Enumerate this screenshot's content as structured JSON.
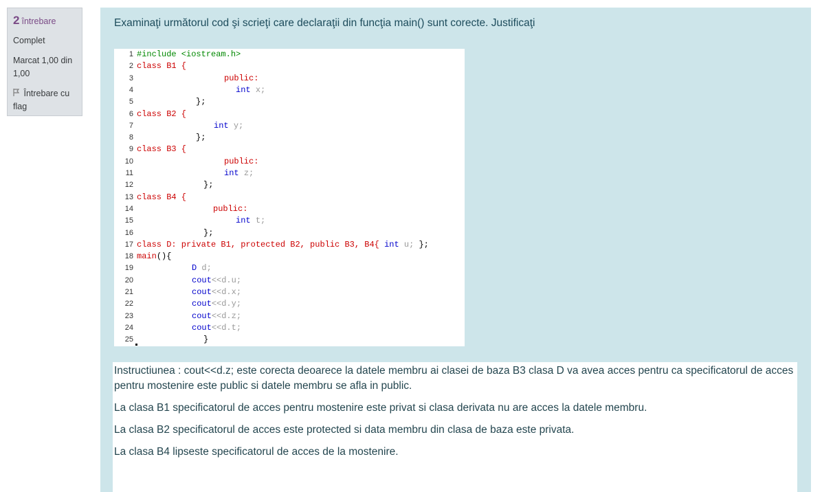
{
  "question_info": {
    "number": "2",
    "label": "întrebare",
    "status": "Complet",
    "mark": "Marcat 1,00 din 1,00",
    "flag_label": "Întrebare cu flag"
  },
  "question": {
    "text": "Examinaţi următorul cod şi scrieţi care declaraţii din funcţia main() sunt corecte. Justificaţi"
  },
  "code_lines": [
    {
      "n": "1",
      "indent": 0,
      "parts": [
        [
          "pp",
          "#include <iostream.h>"
        ]
      ]
    },
    {
      "n": "2",
      "indent": 0,
      "parts": [
        [
          "kw",
          "class B1 {"
        ]
      ]
    },
    {
      "n": "3",
      "indent": 127,
      "parts": [
        [
          "kw",
          "public:"
        ]
      ]
    },
    {
      "n": "4",
      "indent": 144,
      "parts": [
        [
          "ty",
          "int "
        ],
        [
          "id",
          "x;"
        ]
      ]
    },
    {
      "n": "5",
      "indent": 86,
      "parts": [
        [
          "",
          "};"
        ]
      ]
    },
    {
      "n": "6",
      "indent": 0,
      "parts": [
        [
          "kw",
          "class B2 {"
        ]
      ]
    },
    {
      "n": "7",
      "indent": 112,
      "parts": [
        [
          "ty",
          "int "
        ],
        [
          "id",
          "y;"
        ]
      ]
    },
    {
      "n": "8",
      "indent": 86,
      "parts": [
        [
          "",
          "};"
        ]
      ]
    },
    {
      "n": "9",
      "indent": 0,
      "parts": [
        [
          "kw",
          "class B3 {"
        ]
      ]
    },
    {
      "n": "10",
      "indent": 127,
      "parts": [
        [
          "kw",
          "public:"
        ]
      ]
    },
    {
      "n": "11",
      "indent": 127,
      "parts": [
        [
          "ty",
          "int "
        ],
        [
          "id",
          "z;"
        ]
      ]
    },
    {
      "n": "12",
      "indent": 97,
      "parts": [
        [
          "",
          "};"
        ]
      ]
    },
    {
      "n": "13",
      "indent": 0,
      "parts": [
        [
          "kw",
          "class B4 {"
        ]
      ]
    },
    {
      "n": "14",
      "indent": 111,
      "parts": [
        [
          "kw",
          "public:"
        ]
      ]
    },
    {
      "n": "15",
      "indent": 144,
      "parts": [
        [
          "ty",
          "int "
        ],
        [
          "id",
          "t;"
        ]
      ]
    },
    {
      "n": "16",
      "indent": 97,
      "parts": [
        [
          "",
          "};"
        ]
      ]
    },
    {
      "n": "17",
      "indent": 0,
      "parts": [
        [
          "kw",
          "class D: private B1, protected B2, public B3, B4{ "
        ],
        [
          "ty",
          "int "
        ],
        [
          "id",
          "u; "
        ],
        [
          "",
          "};"
        ]
      ]
    },
    {
      "n": "18",
      "indent": 0,
      "parts": [
        [
          "kw",
          "main"
        ],
        [
          "",
          "(){"
        ]
      ]
    },
    {
      "n": "19",
      "indent": 80,
      "parts": [
        [
          "ty",
          "D "
        ],
        [
          "id",
          "d;"
        ]
      ]
    },
    {
      "n": "20",
      "indent": 80,
      "parts": [
        [
          "ty",
          "cout"
        ],
        [
          "id",
          "<<d.u;"
        ]
      ]
    },
    {
      "n": "21",
      "indent": 80,
      "parts": [
        [
          "ty",
          "cout"
        ],
        [
          "id",
          "<<d.x;"
        ]
      ]
    },
    {
      "n": "22",
      "indent": 80,
      "parts": [
        [
          "ty",
          "cout"
        ],
        [
          "id",
          "<<d.y;"
        ]
      ]
    },
    {
      "n": "23",
      "indent": 80,
      "parts": [
        [
          "ty",
          "cout"
        ],
        [
          "id",
          "<<d.z;"
        ]
      ]
    },
    {
      "n": "24",
      "indent": 80,
      "parts": [
        [
          "ty",
          "cout"
        ],
        [
          "id",
          "<<d.t;"
        ]
      ]
    },
    {
      "n": "25",
      "indent": 97,
      "parts": [
        [
          "",
          "}"
        ]
      ]
    }
  ],
  "answer": {
    "paragraphs": [
      "Instructiunea :  cout<<d.z; este corecta deoarece la datele membru ai clasei de baza B3 clasa D va avea acces pentru ca specificatorul de acces pentru mostenire este public si datele membru se afla in public.",
      "La clasa B1 specificatorul de acces pentru mostenire este privat si clasa derivata nu are acces la datele membru.",
      "La clasa B2 specificatorul de acces este protected si data membru din clasa de baza este privata.",
      "La clasa B4 lipseste specificatorul de acces de la mostenire."
    ]
  },
  "colors": {
    "content_bg": "#cde5ea",
    "info_bg": "#dee2e6",
    "keyword": "#cc0000",
    "type": "#0000cc",
    "identifier": "#999999",
    "preprocessor": "#008800"
  }
}
